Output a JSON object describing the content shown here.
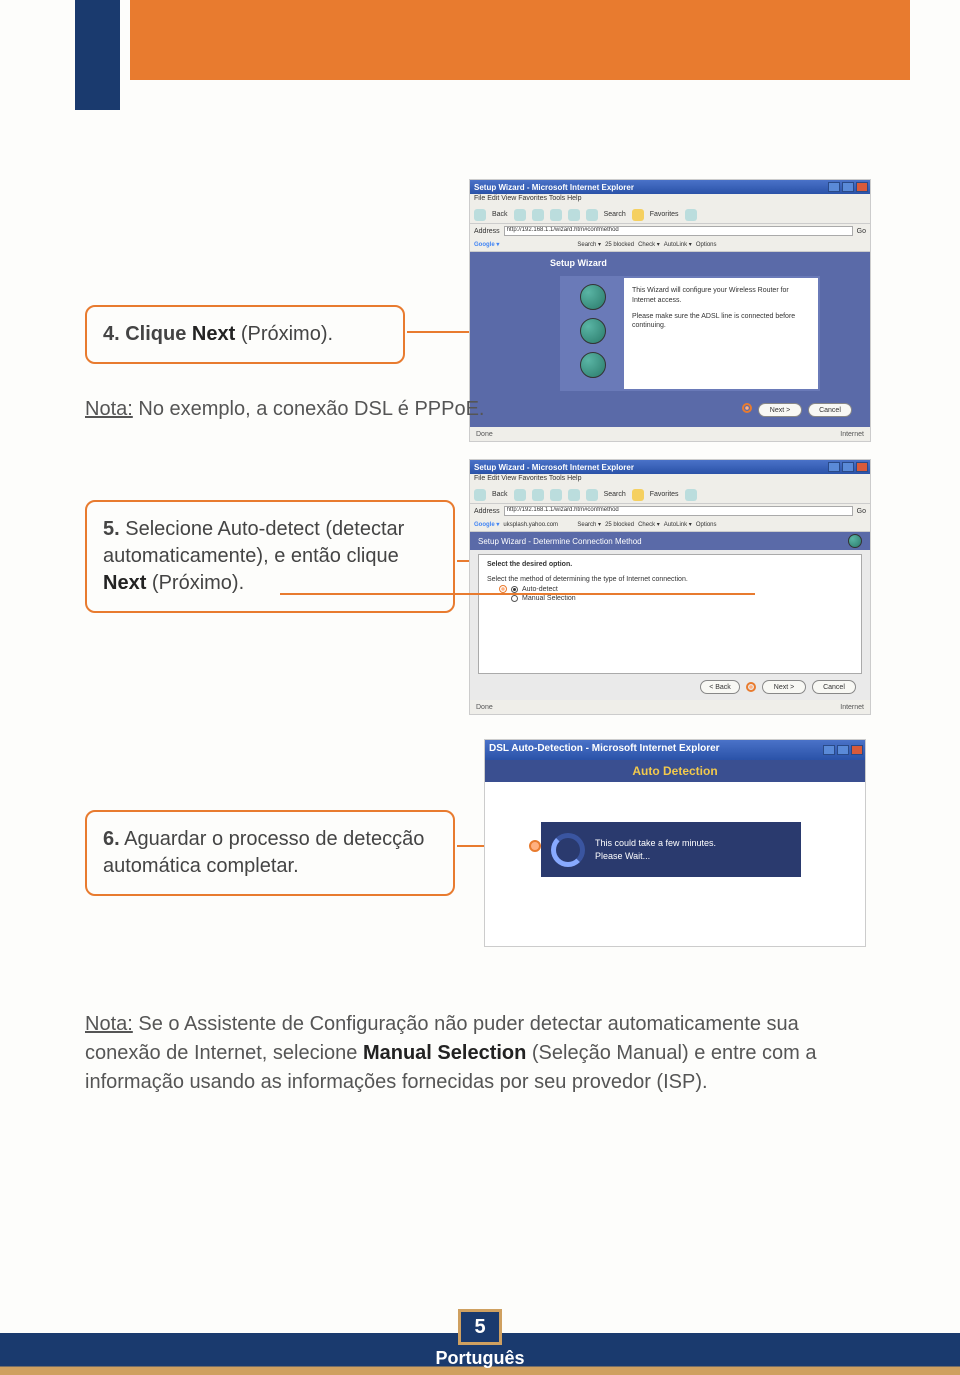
{
  "header": {},
  "step4": {
    "text_before": "4. Clique ",
    "bold": "Next",
    "text_after": " (Próximo)."
  },
  "note1": {
    "label": "Nota:",
    "text": " No exemplo, a conexão DSL é PPPoE."
  },
  "step5": {
    "num": "5.",
    "pre": " Selecione Auto-detect (detectar automaticamente), e então clique ",
    "bold": "Next",
    "post": " (Próximo)."
  },
  "step6": {
    "num": "6.",
    "text": " Aguardar o processo de detecção automática completar."
  },
  "note2": {
    "label": "Nota:",
    "text1": " Se o Assistente de Configuração não puder detectar automaticamente sua conexão de Internet, selecione ",
    "bold": "Manual Selection",
    "text2": " (Seleção Manual) e entre com a informação usando  as informações fornecidas por seu provedor (ISP)."
  },
  "shot1": {
    "title": "Setup Wizard - Microsoft Internet Explorer",
    "menubar": "File   Edit   View   Favorites   Tools   Help",
    "back": "Back",
    "search": "Search",
    "favorites": "Favorites",
    "address_label": "Address",
    "address": "http://192.168.1.1/wizard.htm#confmethod",
    "go": "Go",
    "google": "Google ▾",
    "g_search": "Search ▾",
    "g_blocked": "25 blocked",
    "g_check": "Check ▾",
    "g_autolink": "AutoLink ▾",
    "g_options": "Options",
    "wiz_title": "Setup Wizard",
    "wiz_text1": "This Wizard will configure your Wireless Router for Internet access.",
    "wiz_text2": "Please make sure the ADSL line is connected before continuing.",
    "btn_next": "Next >",
    "btn_cancel": "Cancel",
    "status_done": "Done",
    "status_internet": "Internet"
  },
  "shot2": {
    "title": "Setup Wizard - Microsoft Internet Explorer",
    "menubar": "File   Edit   View   Favorites   Tools   Help",
    "back": "Back",
    "search": "Search",
    "favorites": "Favorites",
    "address_label": "Address",
    "address": "http://192.168.1.1/wizard.htm#confmethod",
    "go": "Go",
    "google": "Google ▾",
    "g_searchfield": "uksplash.yahoo.com",
    "g_search": "Search ▾",
    "g_blocked": "25 blocked",
    "g_check": "Check ▾",
    "g_autolink": "AutoLink ▾",
    "g_options": "Options",
    "head": "Setup Wizard - Determine Connection Method",
    "sel": "Select the desired option.",
    "method": "Select the method of determining the type of Internet connection.",
    "opt1": "Auto-detect",
    "opt2": "Manual Selection",
    "btn_back": "< Back",
    "btn_next": "Next >",
    "btn_cancel": "Cancel",
    "status_done": "Done",
    "status_internet": "Internet"
  },
  "shot3": {
    "title": "DSL Auto-Detection - Microsoft Internet Explorer",
    "head": "Auto Detection",
    "text1": "This could take a few minutes.",
    "text2": "Please Wait..."
  },
  "footer": {
    "page": "5",
    "lang": "Português"
  }
}
